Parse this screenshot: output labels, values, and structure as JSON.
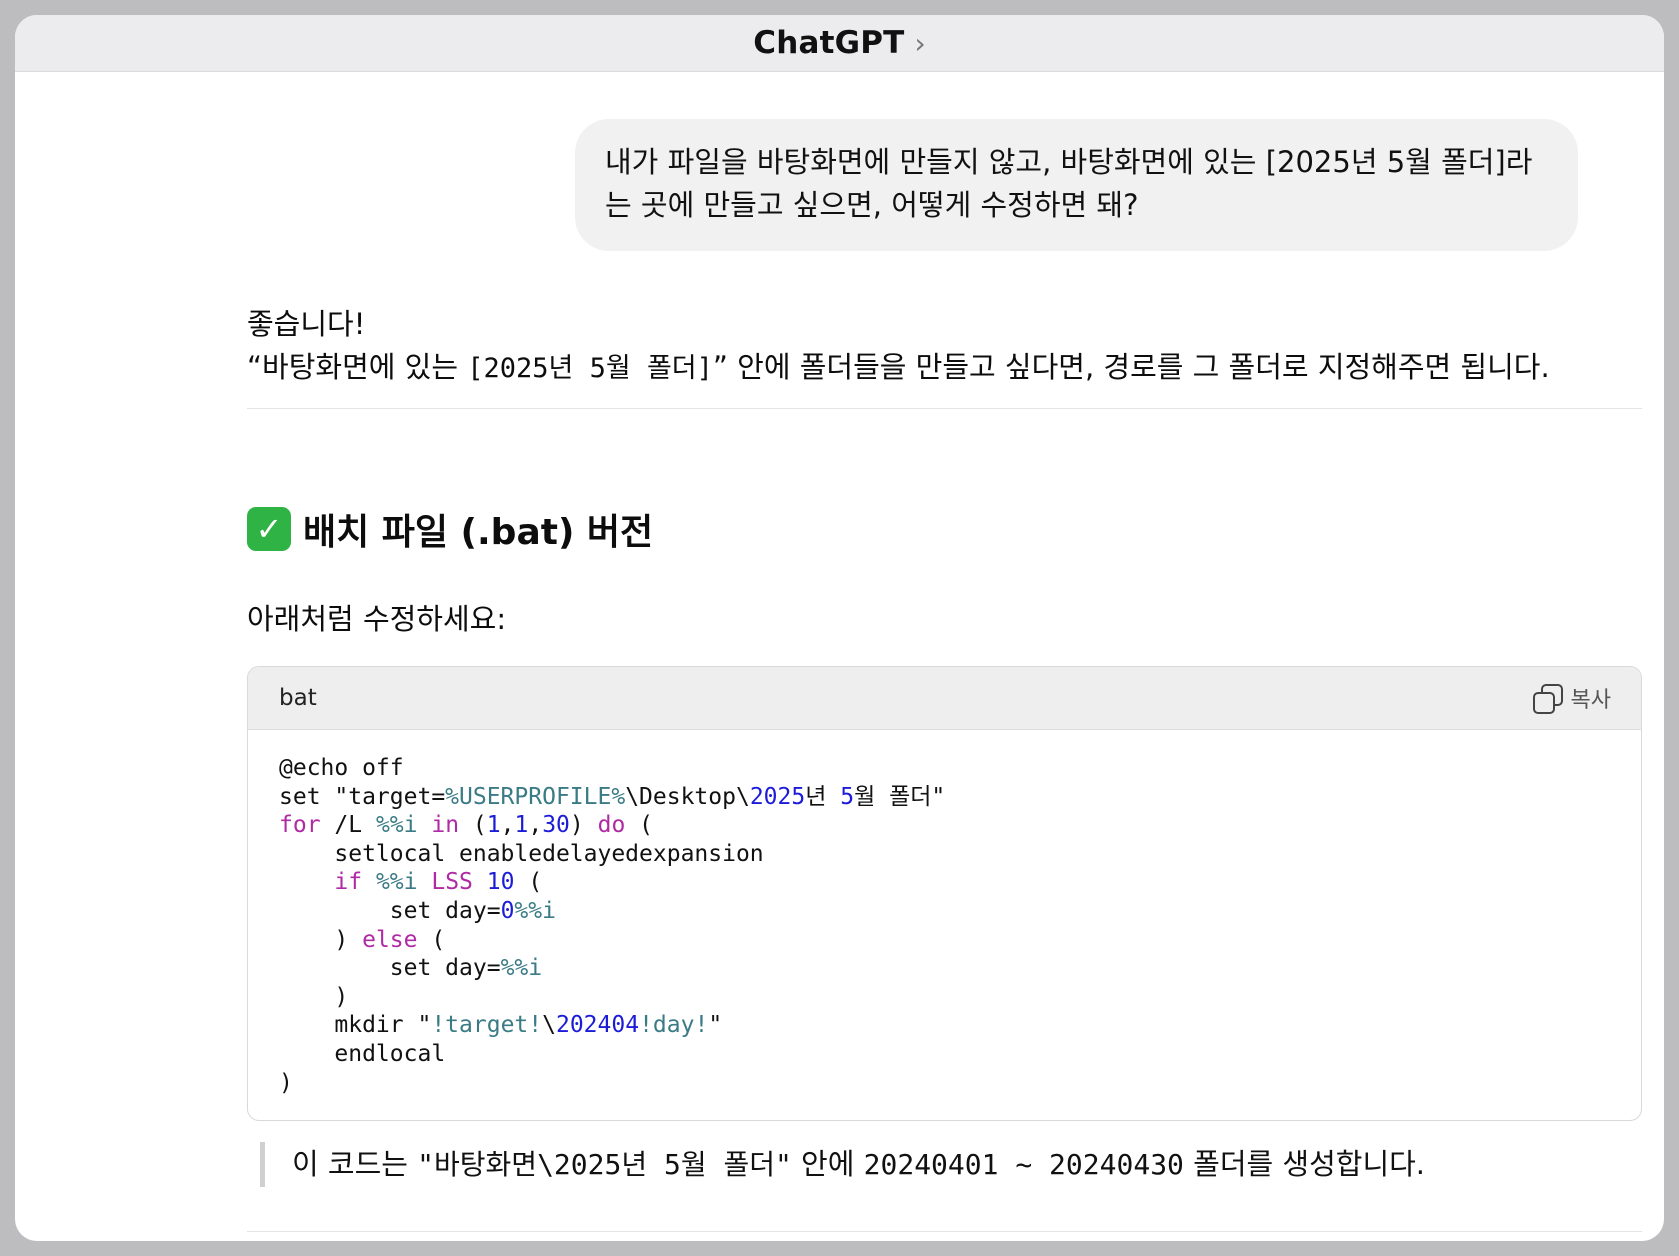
{
  "header": {
    "title": "ChatGPT"
  },
  "user_message": "내가 파일을 바탕화면에 만들지 않고, 바탕화면에 있는 [2025년 5월 폴더]라는 곳에 만들고 싶으면, 어떻게 수정하면 돼?",
  "answer": {
    "greeting": "좋습니다!",
    "intro_before": "“바탕화면에 있는 ",
    "intro_code": "[2025년 5월 폴더]",
    "intro_after": "” 안에 폴더들을 만들고 싶다면, 경로를 그 폴더로 지정해주면 됩니다.",
    "section_emoji": "✓",
    "section_title": "배치 파일 (.bat) 버전",
    "lead": "아래처럼 수정하세요:"
  },
  "code_block": {
    "language": "bat",
    "copy_label": "복사",
    "lines": [
      "@echo off",
      "set \"target=%USERPROFILE%\\Desktop\\2025년 5월 폴더\"",
      "for /L %%i in (1,1,30) do (",
      "    setlocal enabledelayedexpansion",
      "    if %%i LSS 10 (",
      "        set day=0%%i",
      "    ) else (",
      "        set day=%%i",
      "    )",
      "    mkdir \"!target!\\202404!day!\"",
      "    endlocal",
      ")"
    ]
  },
  "note": {
    "prefix": "이 코드는 ",
    "path": "\"바탕화면\\2025년 5월 폴더\"",
    "middle": " 안에 ",
    "range": "20240401 ~ 20240430",
    "suffix": " 폴더를 생성합니다."
  },
  "colors": {
    "keyword": "#b02aa3",
    "number": "#1c1cd8",
    "variable": "#3a7b85",
    "check_green": "#2fb344"
  },
  "icons": [
    "chevron-right-icon",
    "check-mark-icon",
    "copy-icon"
  ]
}
